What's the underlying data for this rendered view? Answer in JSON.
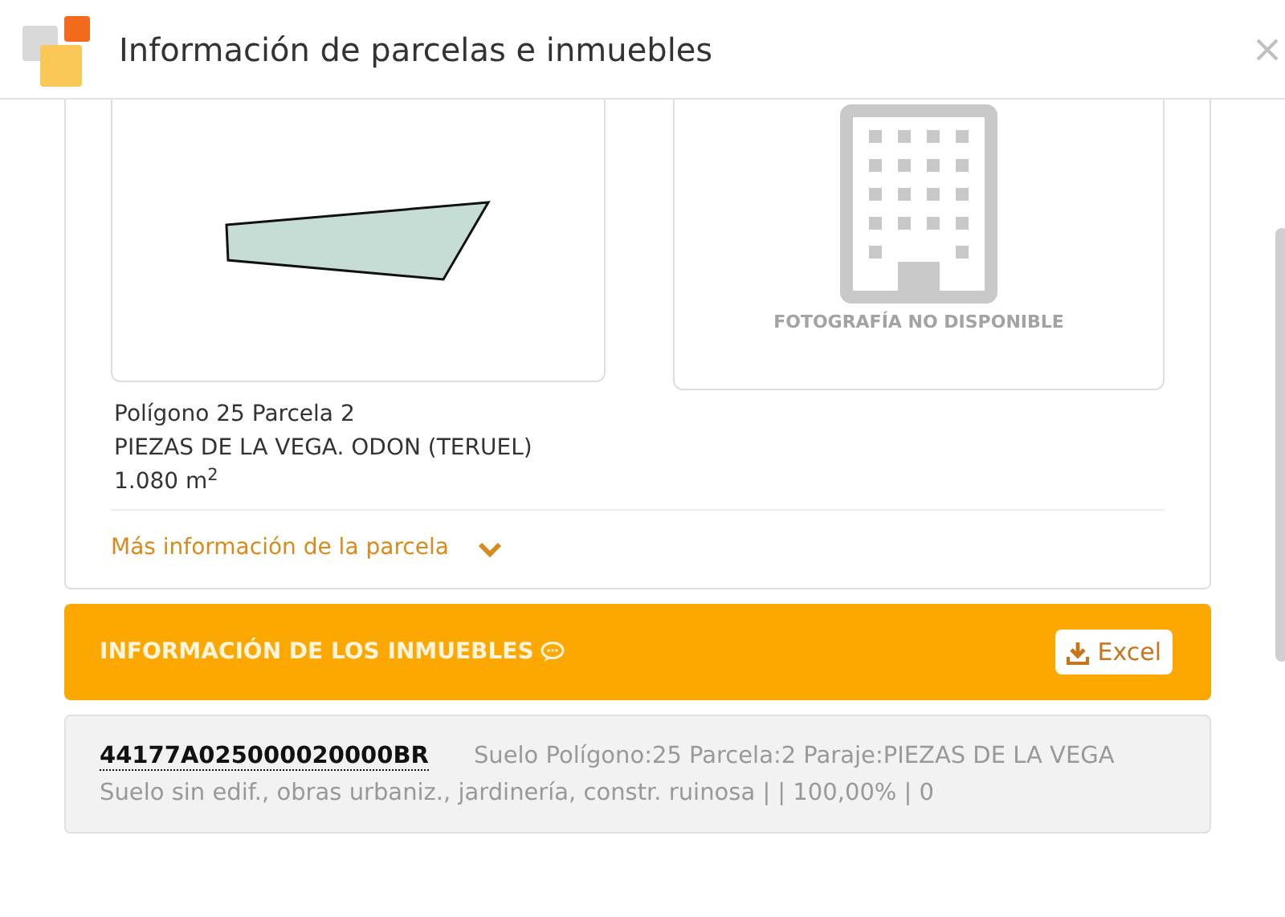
{
  "window": {
    "title": "Información de parcelas e inmuebles"
  },
  "parcel": {
    "photo_caption": "FOTOGRAFÍA NO DISPONIBLE",
    "name": "Polígono 25 Parcela 2",
    "location": "PIEZAS DE LA VEGA. ODON (TERUEL)",
    "area": "1.080 m$^{2}$",
    "more_link": "Más información de la parcela",
    "expanded": false
  },
  "properties": {
    "title": "INFORMACIÓN DE LOS INMUEBLES",
    "export_button": "Excel",
    "items": [
      {
        "reference": "44177A025000020000BR",
        "description": "Suelo Polígono:25 Parcela:2 Paraje:PIEZAS DE LA VEGA",
        "details": "Suelo sin edif., obras urbaniz., jardinería, constr. ruinosa | | 100,00% | 0"
      }
    ]
  }
}
